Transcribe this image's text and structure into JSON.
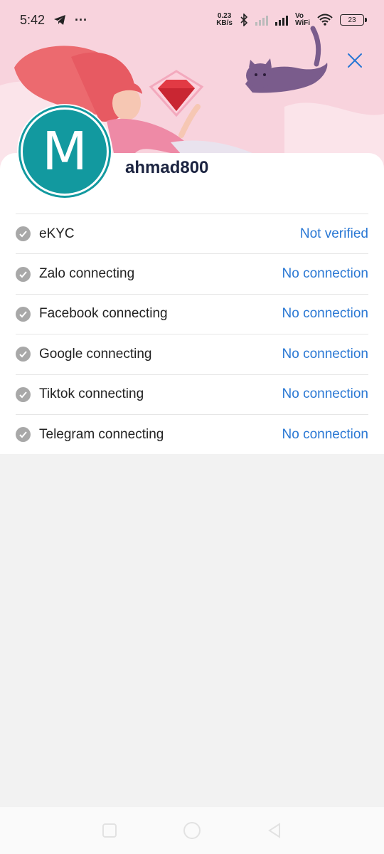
{
  "status_bar": {
    "time": "5:42",
    "more": "···",
    "net_speed_value": "0.23",
    "net_speed_unit": "KB/s",
    "vowifi_top": "Vo",
    "vowifi_bottom": "WiFi",
    "battery": "23"
  },
  "profile": {
    "avatar_letter": "M",
    "username": "ahmad800"
  },
  "rows": [
    {
      "label": "eKYC",
      "value": "Not verified"
    },
    {
      "label": "Zalo connecting",
      "value": "No connection"
    },
    {
      "label": "Facebook connecting",
      "value": "No connection"
    },
    {
      "label": "Google connecting",
      "value": "No connection"
    },
    {
      "label": "Tiktok connecting",
      "value": "No connection"
    },
    {
      "label": "Telegram connecting",
      "value": "No connection"
    }
  ],
  "icons": {
    "close": "close-icon",
    "check": "check-circle-icon",
    "telegram": "telegram-icon",
    "bluetooth": "bluetooth-icon",
    "wifi": "wifi-icon"
  },
  "colors": {
    "header_bg": "#f8d3dd",
    "avatar_bg": "#12999f",
    "link": "#2a78d4",
    "username": "#1b2340"
  }
}
